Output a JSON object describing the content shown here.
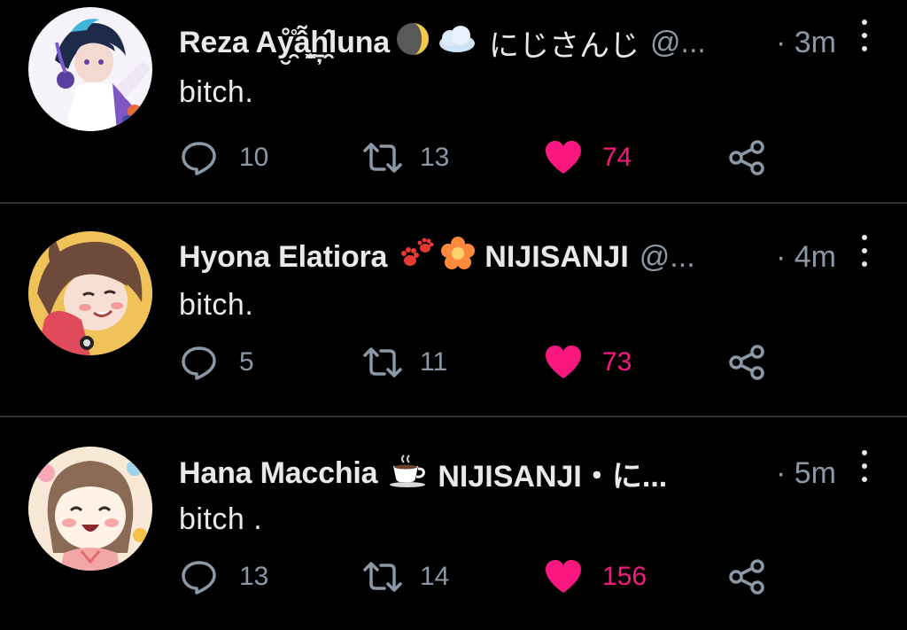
{
  "theme": {
    "background": "#000000",
    "text_primary": "#e7e9ea",
    "text_secondary": "#8b98a5",
    "like_color": "#f91880",
    "divider": "#2f3336"
  },
  "tweets": [
    {
      "display_name": "Reza Aẙ̮̯̊ẫ̟̬̯ẖ̦̯̂luna",
      "badges": [
        "moon-icon",
        "cloud-icon"
      ],
      "affiliation": "にじさんじ",
      "handle": "@...",
      "time": "· 3m",
      "text": "bitch.",
      "reply_count": "10",
      "retweet_count": "13",
      "like_count": "74",
      "liked": true
    },
    {
      "display_name": "Hyona Elatiora",
      "badges": [
        "paw-print-icon",
        "flower-icon"
      ],
      "affiliation": "NIJISANJI",
      "handle": "@...",
      "time": "· 4m",
      "text": "bitch.",
      "reply_count": "5",
      "retweet_count": "11",
      "like_count": "73",
      "liked": true
    },
    {
      "display_name": "Hana Macchia",
      "badges": [
        "coffee-cup-icon"
      ],
      "affiliation": "NIJISANJI・に...",
      "handle": "",
      "time": "· 5m",
      "text": "bitch .",
      "reply_count": "13",
      "retweet_count": "14",
      "like_count": "156",
      "liked": true
    }
  ]
}
